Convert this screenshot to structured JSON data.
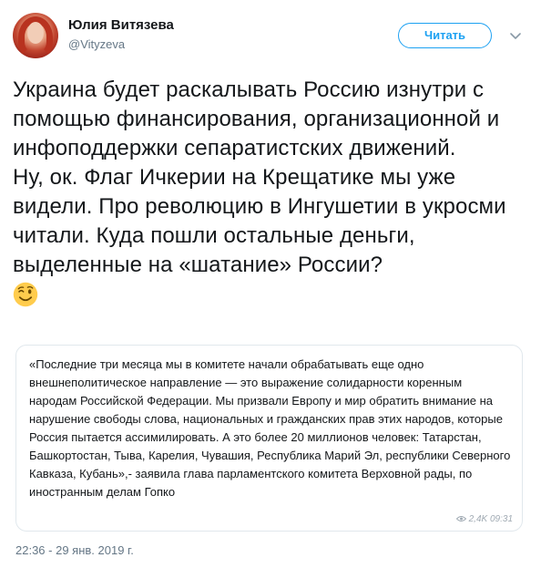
{
  "user": {
    "name": "Юлия Витязева",
    "handle": "@Vityzeva"
  },
  "follow_button": {
    "label": "Читать"
  },
  "tweet": {
    "paragraph1": "Украина будет раскалывать Россию изнутри с помощью финансирования, организационной и инфоподдержки сепаратистских движений.",
    "paragraph2": "Ну, ок. Флаг Ичкерии на Крещатике мы уже видели. Про революцию в Ингушетии в укросми читали. Куда пошли остальные деньги, выделенные на «шатание» России?",
    "emoji": "winking-face"
  },
  "quote": {
    "text": "«Последние три месяца мы в комитете начали обрабатывать еще одно внешнеполитическое направление — это выражение солидарности коренным народам Российской Федерации. Мы призвали Европу и мир обратить внимание на нарушение свободы слова, национальных и гражданских прав этих народов, которые Россия пытается ассимилировать. А это более 20 миллионов человек: Татарстан, Башкортостан, Тыва, Карелия, Чувашия, Республика Марий Эл, республики Северного Кавказа, Кубань»,- заявила глава парламентского комитета Верховной рады, по иностранным делам Гопко",
    "meta": "2,4K 09:31"
  },
  "timestamp": "22:36 - 29 янв. 2019 г.",
  "colors": {
    "accent": "#1da1f2",
    "text": "#14171a",
    "secondary": "#657786",
    "border": "#e1e8ed"
  }
}
